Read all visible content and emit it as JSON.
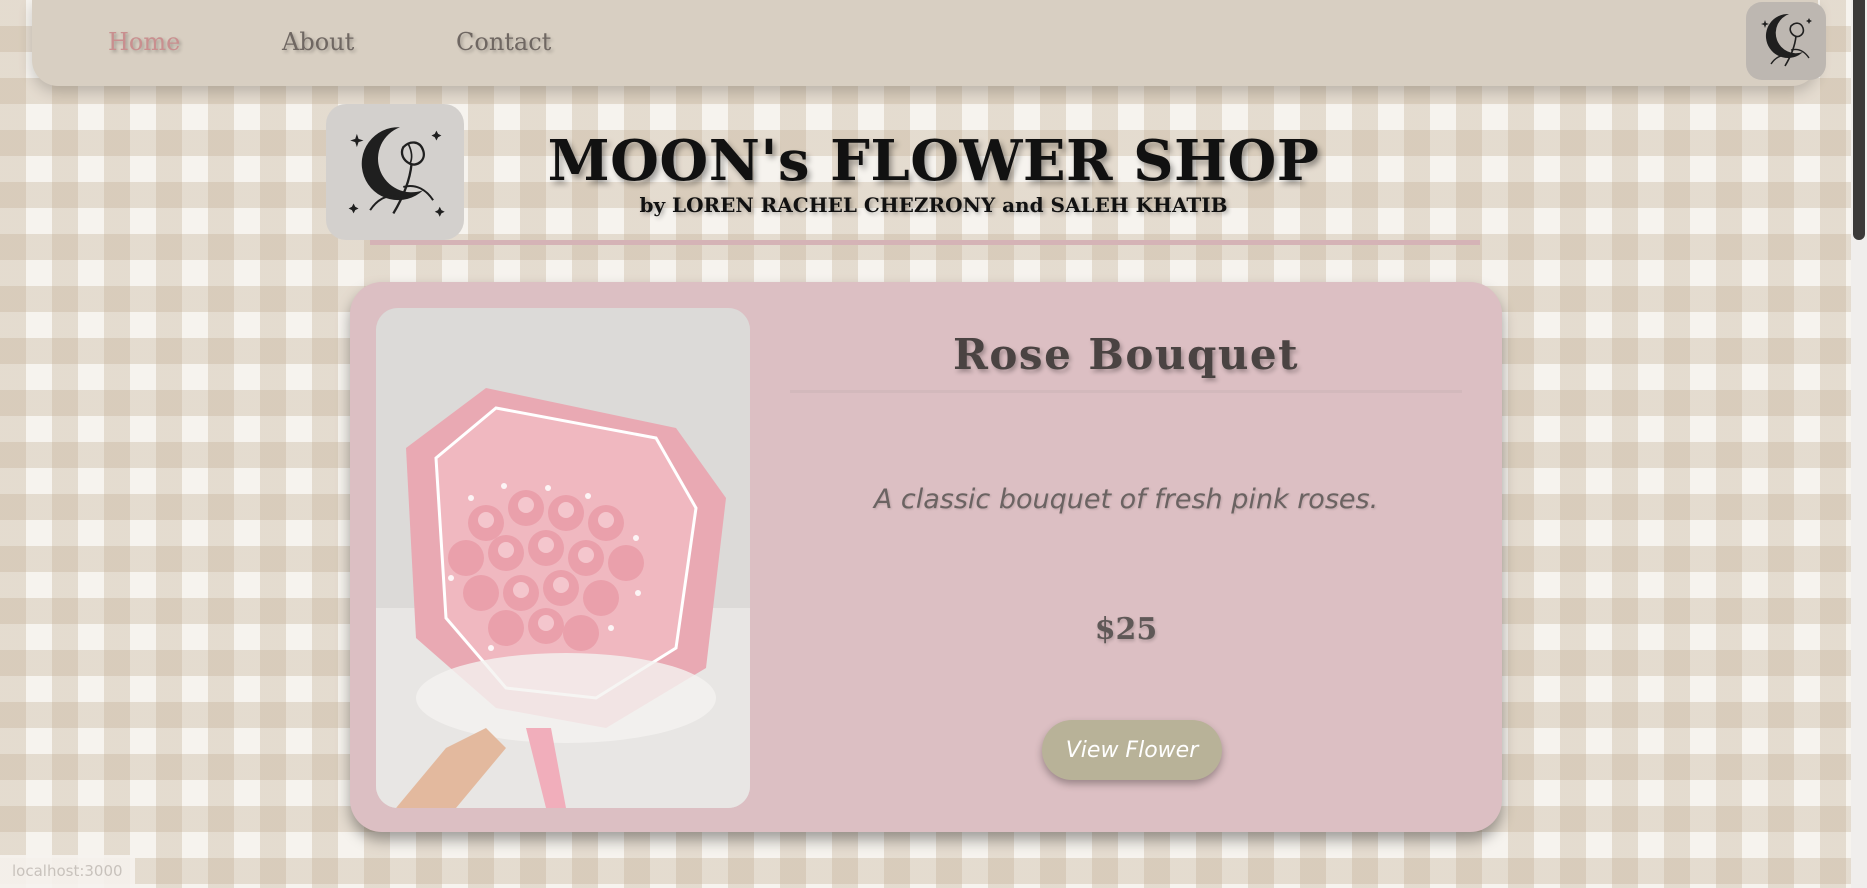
{
  "nav": {
    "links": [
      {
        "label": "Home",
        "active": true
      },
      {
        "label": "About",
        "active": false
      },
      {
        "label": "Contact",
        "active": false
      }
    ],
    "logo_icon": "moon-flower-logo-icon"
  },
  "header": {
    "title": "MOON's FLOWER SHOP",
    "subtitle": "by LOREN RACHEL CHEZRONY and SALEH KHATIB",
    "logo_icon": "moon-flower-logo-icon"
  },
  "product": {
    "title": "Rose Bouquet",
    "description": "A classic bouquet of fresh pink roses.",
    "price": "$25",
    "button_label": "View Flower",
    "image_icon": "rose-bouquet-image"
  },
  "status": {
    "url": "localhost:3000"
  },
  "colors": {
    "nav_bg": "#d8cfc2",
    "card_bg": "#dcbfc3",
    "active_link": "#c98f8f",
    "button_bg": "#b8b298"
  }
}
